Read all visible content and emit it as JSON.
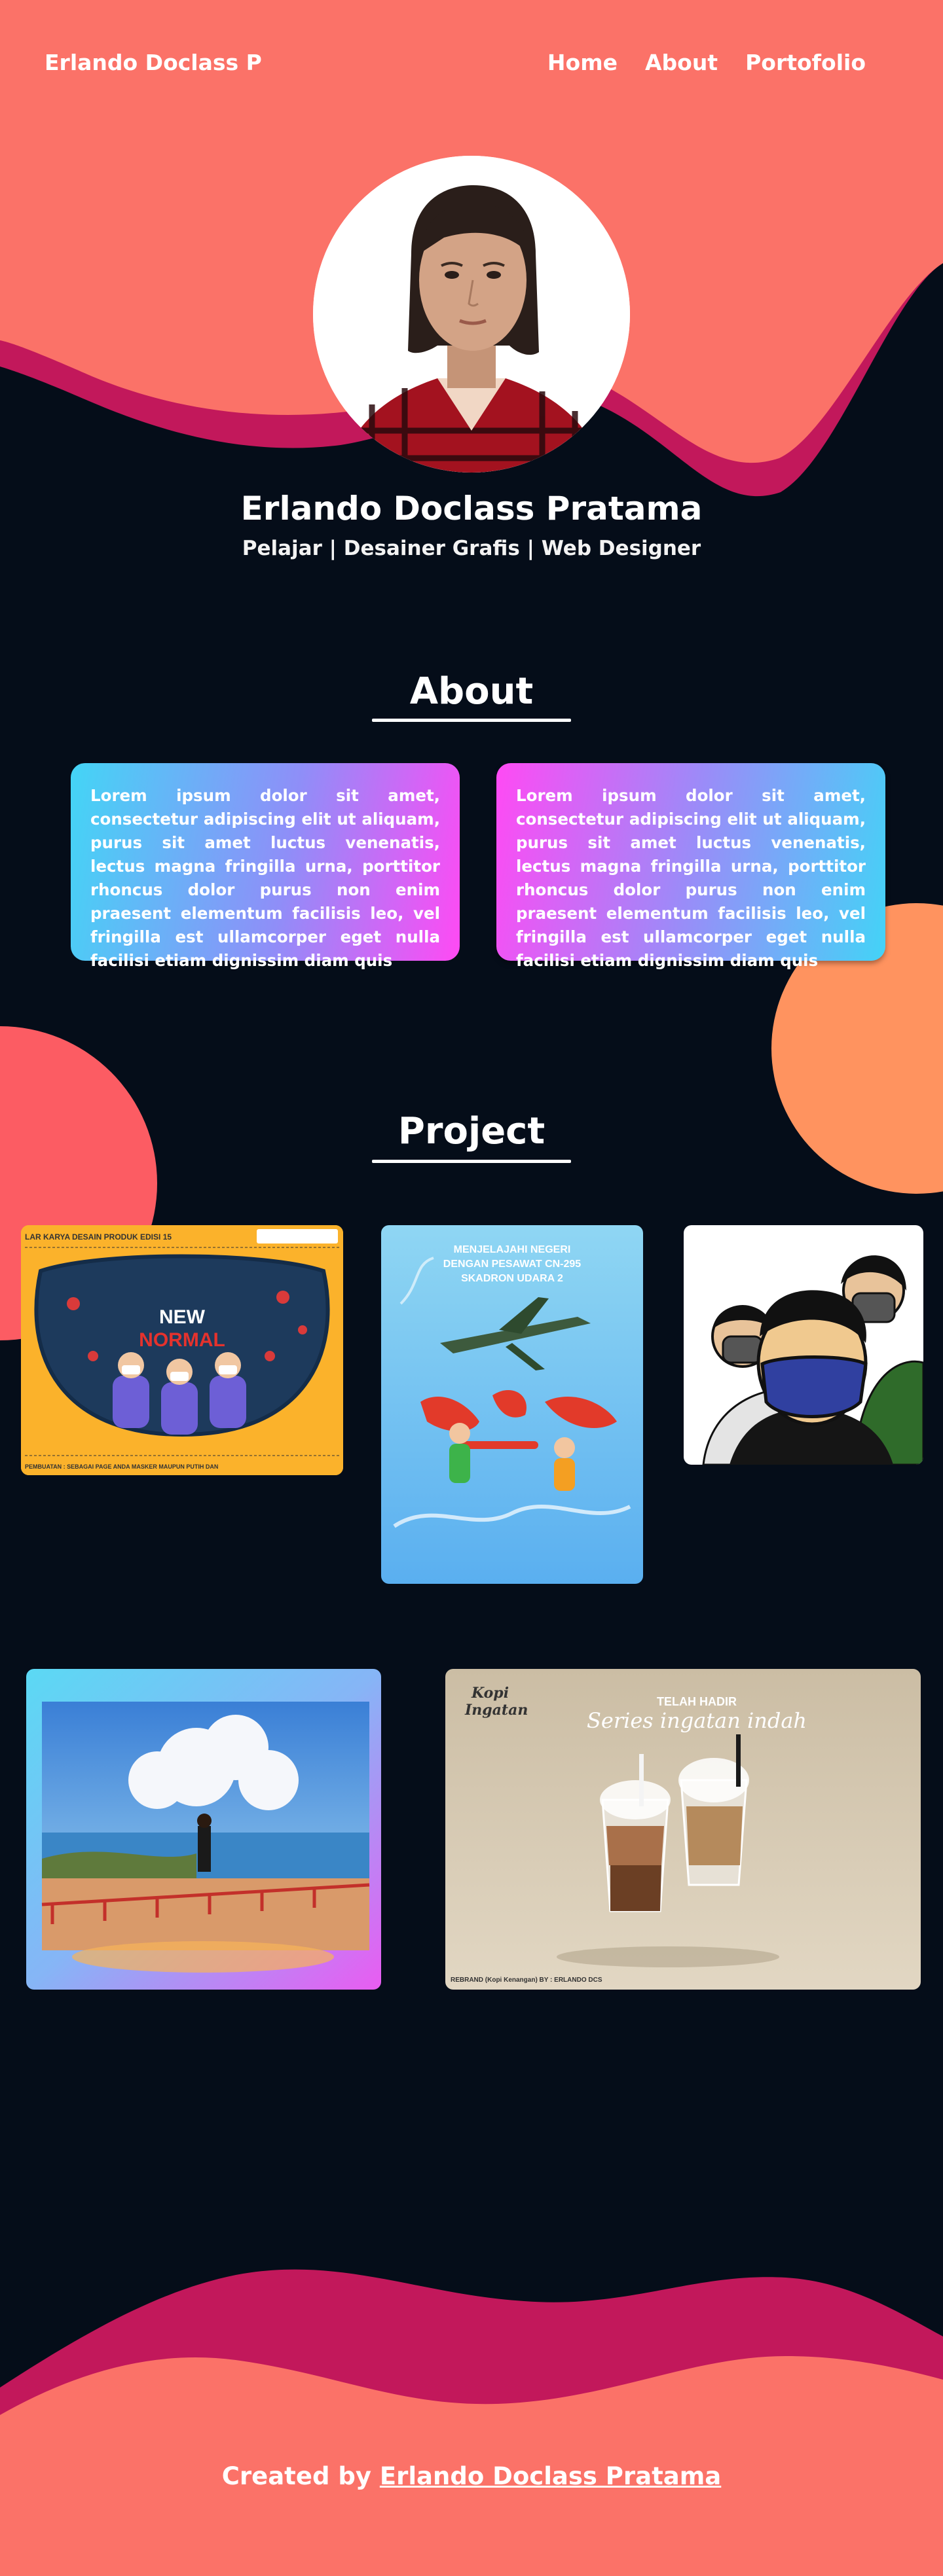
{
  "navbar": {
    "brand": "Erlando Doclass P",
    "links": [
      "Home",
      "About",
      "Portofolio"
    ]
  },
  "profile": {
    "name": "Erlando Doclass Pratama",
    "subtitle": "Pelajar | Desainer Grafis | Web Designer"
  },
  "about": {
    "title": "About",
    "cards": [
      "Lorem ipsum dolor sit amet, consectetur adipiscing elit ut aliquam, purus sit amet luctus venenatis, lectus magna fringilla urna, porttitor rhoncus dolor purus non enim praesent elementum facilisis leo, vel fringilla est ullamcorper eget nulla facilisi etiam dignissim diam quis",
      "Lorem ipsum dolor sit amet, consectetur adipiscing elit ut aliquam, purus sit amet luctus venenatis, lectus magna fringilla urna, porttitor rhoncus dolor purus non enim praesent elementum facilisis leo, vel fringilla est ullamcorper eget nulla facilisi etiam dignissim diam quis"
    ]
  },
  "project": {
    "title": "Project",
    "items": [
      {
        "name": "new-normal",
        "header": "LAR KARYA DESAIN PRODUK EDISI 15",
        "line1": "NEW",
        "line2": "NORMAL",
        "footer": "PEMBUATAN : SEBAGAI PAGE ANDA MASKER MAUPUN PUTIH DAN"
      },
      {
        "name": "pesawat",
        "line1": "MENJELAJAHI NEGERI",
        "line2": "DENGAN PESAWAT CN-295",
        "line3": "SKADRON UDARA 2"
      },
      {
        "name": "masker-portrait"
      },
      {
        "name": "landscape"
      },
      {
        "name": "kopi",
        "logo1": "Kopi",
        "logo2": "Ingatan",
        "top": "TELAH HADIR",
        "script": "Series ingatan indah",
        "footer": "REBRAND (Kopi Kenangan) BY : ERLANDO DCS"
      }
    ]
  },
  "footer": {
    "prefix": "Created by ",
    "author": "Erlando Doclass Pratama"
  },
  "colors": {
    "background": "#050d19",
    "coral": "#fb7268",
    "magenta": "#c2185b",
    "orange": "#ff935f",
    "red_blob": "#fc5c63"
  }
}
